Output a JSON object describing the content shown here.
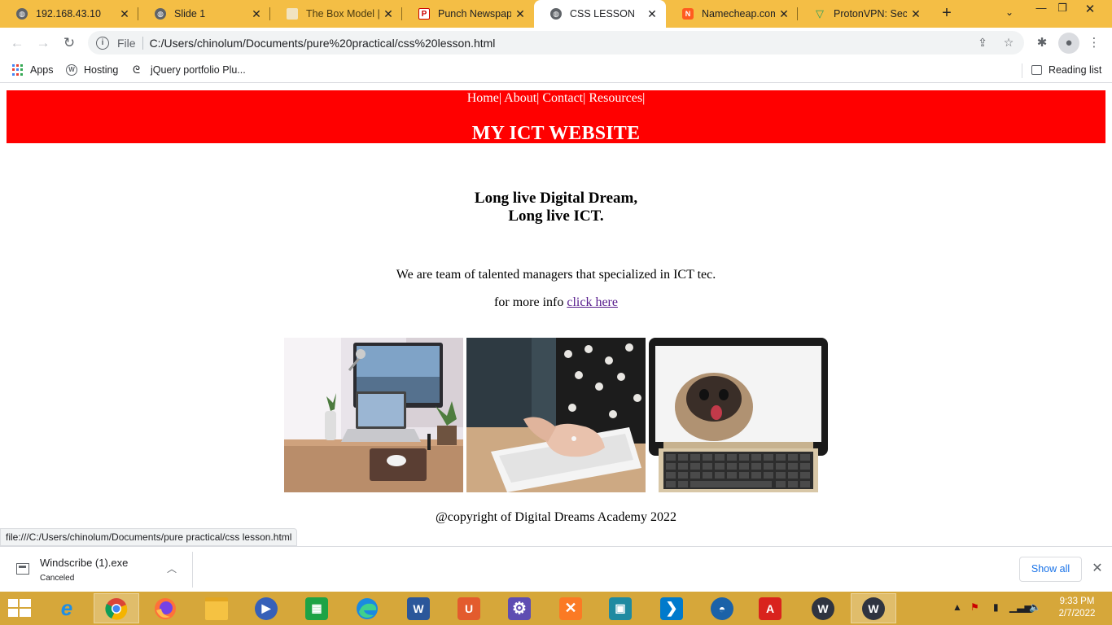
{
  "browser": {
    "tabs": [
      {
        "title": "192.168.43.10",
        "icon": "globe-icon"
      },
      {
        "title": "Slide 1",
        "icon": "globe-icon"
      },
      {
        "title": "The Box Model | Ti",
        "icon": "generic-page-icon"
      },
      {
        "title": "Punch Newspaper",
        "icon": "punch-logo-icon"
      },
      {
        "title": "CSS LESSON",
        "icon": "globe-icon",
        "active": true
      },
      {
        "title": "Namecheap.com",
        "icon": "namecheap-icon"
      },
      {
        "title": "ProtonVPN: Secur",
        "icon": "protonvpn-icon"
      }
    ],
    "new_tab_label": "+",
    "address": {
      "scheme_label": "File",
      "url": "C:/Users/chinolum/Documents/pure%20practical/css%20lesson.html"
    },
    "bookmarks": [
      {
        "label": "Apps",
        "icon": "apps-grid-icon"
      },
      {
        "label": "Hosting",
        "icon": "wordpress-icon"
      },
      {
        "label": "jQuery portfolio Plu...",
        "icon": "jquery-icon"
      }
    ],
    "reading_list_label": "Reading list",
    "status_url": "file:///C:/Users/chinolum/Documents/pure practical/css lesson.html"
  },
  "page": {
    "nav": [
      "Home",
      "About",
      "Contact",
      "Resources"
    ],
    "nav_separator": "|",
    "site_title": "MY ICT WEBSITE",
    "slogan_line1": "Long live Digital Dream,",
    "slogan_line2": "Long live ICT.",
    "intro": "We are team of talented managers that specialized in ICT tec.",
    "more_info_prefix": "for more info",
    "more_info_link": "click here",
    "images": [
      {
        "alt": "desk-workspace-photo"
      },
      {
        "alt": "typing-keyboard-photo"
      },
      {
        "alt": "laptop-pug-photo"
      }
    ],
    "copyright": "@copyright of Digital Dreams Academy 2022",
    "colors": {
      "header_bg": "#ff0000",
      "header_text": "#ffffff",
      "link_visited": "#551a8b"
    }
  },
  "downloads": {
    "file_name": "Windscribe (1).exe",
    "file_status": "Canceled",
    "show_all_label": "Show all"
  },
  "taskbar": {
    "apps": [
      "internet-explorer",
      "chrome",
      "firefox",
      "file-explorer",
      "media-player",
      "store",
      "edge",
      "word",
      "uniconverter",
      "settings",
      "xampp",
      "photos",
      "vscode",
      "ucbrowser",
      "acrobat",
      "windscribe",
      "windscribe-2"
    ],
    "time": "9:33 PM",
    "date": "2/7/2022"
  }
}
